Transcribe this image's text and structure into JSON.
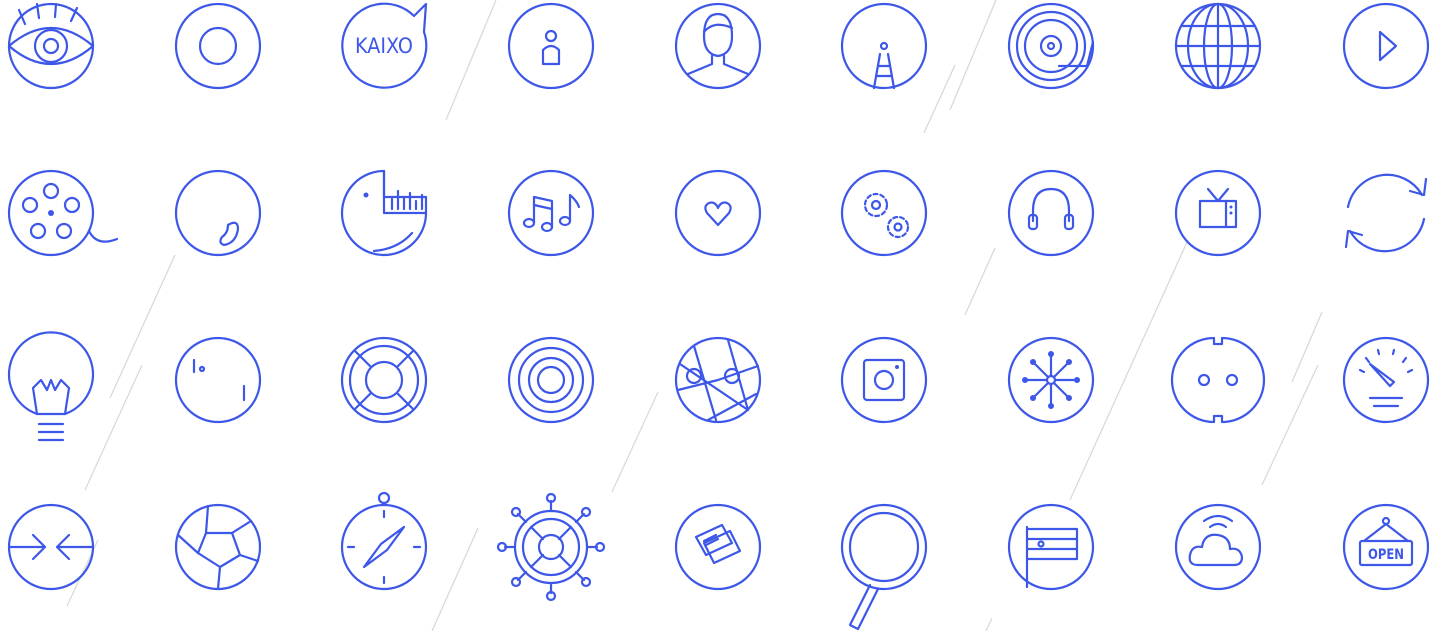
{
  "theme": {
    "stroke": "#3d57e8",
    "background": "#ffffff",
    "decor_lines": "#d9d7cf"
  },
  "icons": [
    {
      "name": "eye-icon"
    },
    {
      "name": "ring-icon"
    },
    {
      "name": "speech-bubble-icon",
      "text": "KAIXO"
    },
    {
      "name": "person-icon"
    },
    {
      "name": "user-portrait-icon"
    },
    {
      "name": "road-icon"
    },
    {
      "name": "turntable-icon"
    },
    {
      "name": "globe-icon"
    },
    {
      "name": "play-icon"
    },
    {
      "name": "film-reel-icon"
    },
    {
      "name": "bean-icon"
    },
    {
      "name": "pacman-chart-icon"
    },
    {
      "name": "music-notes-icon"
    },
    {
      "name": "heart-icon"
    },
    {
      "name": "gears-icon"
    },
    {
      "name": "headphones-icon"
    },
    {
      "name": "television-icon"
    },
    {
      "name": "refresh-icon"
    },
    {
      "name": "lightbulb-icon"
    },
    {
      "name": "pong-icon"
    },
    {
      "name": "lifebuoy-icon"
    },
    {
      "name": "target-icon"
    },
    {
      "name": "map-icon"
    },
    {
      "name": "instagram-icon"
    },
    {
      "name": "network-icon"
    },
    {
      "name": "power-socket-icon"
    },
    {
      "name": "speedometer-icon"
    },
    {
      "name": "collapse-arrows-icon"
    },
    {
      "name": "camera-aperture-icon"
    },
    {
      "name": "compass-icon"
    },
    {
      "name": "ship-wheel-icon"
    },
    {
      "name": "tickets-icon"
    },
    {
      "name": "magnifier-icon"
    },
    {
      "name": "flag-icon"
    },
    {
      "name": "wifi-cloud-icon"
    },
    {
      "name": "open-sign-icon",
      "text": "OPEN"
    }
  ]
}
